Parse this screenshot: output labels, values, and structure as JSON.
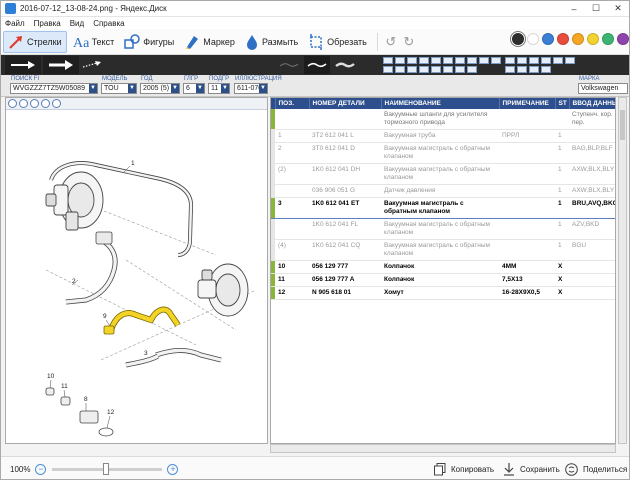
{
  "window": {
    "title": "2016-07-12_13-08-24.png - Яндекс.Диск",
    "min": "–",
    "max": "☐",
    "close": "✕"
  },
  "menu": [
    "Файл",
    "Правка",
    "Вид",
    "Справка"
  ],
  "toolbar": {
    "tools": [
      {
        "label": "Стрелки",
        "icon": "arrow-icon"
      },
      {
        "label": "Текст",
        "icon": "text-icon"
      },
      {
        "label": "Фигуры",
        "icon": "shapes-icon"
      },
      {
        "label": "Маркер",
        "icon": "marker-icon"
      },
      {
        "label": "Размыть",
        "icon": "blur-icon"
      },
      {
        "label": "Обрезать",
        "icon": "crop-icon"
      }
    ],
    "colors": [
      "#2e2e2e",
      "#ffffff",
      "#3a7fd5",
      "#e74c3c",
      "#f5a623",
      "#f1d230",
      "#3cb371",
      "#8e44ad"
    ]
  },
  "catalog": {
    "filters": [
      {
        "label": "ПОИСК FI",
        "value": "WVGZZZ7TZ5W05089"
      },
      {
        "label": "МОДЕЛЬ",
        "value": "TOU"
      },
      {
        "label": "ГОД",
        "value": "2005 (5)"
      },
      {
        "label": "ГЛГР",
        "value": "6"
      },
      {
        "label": "ПОДГР",
        "value": "11"
      },
      {
        "label": "ИЛЛЮСТРАЦИЯ",
        "value": "611-070"
      }
    ],
    "brand_label": "МАРКА",
    "brand_value": "Volkswagen",
    "callouts": [
      "1",
      "2",
      "3",
      "9",
      "10",
      "11",
      "8",
      "12"
    ],
    "table": {
      "headers": [
        "ПОЗ.",
        "НОМЕР ДЕТАЛИ",
        "НАИМЕНОВАНИЕ",
        "ПРИМЕЧАНИЕ",
        "ST",
        "ВВОД ДАННЫХ"
      ],
      "rows": [
        {
          "state": "head",
          "pos": "",
          "part": "",
          "name": "Вакуумные шланги для усилителя тормозного привода",
          "note": "",
          "st": "",
          "data": "Ступенч. кор. пер."
        },
        {
          "state": "ghost",
          "pos": "1",
          "part": "3T2 612 041 L",
          "name": "Вакуумная труба",
          "note": "ПРРЛ",
          "st": "1",
          "data": ""
        },
        {
          "state": "ghost",
          "pos": "2",
          "part": "3T0 612 041 D",
          "name": "Вакуумная магистраль с обратным клапаном",
          "note": "",
          "st": "1",
          "data": "BAG,BLP,BLF"
        },
        {
          "state": "ghost",
          "pos": "(2)",
          "part": "1K0 612 041 DH",
          "name": "Вакуумная магистраль с обратным клапаном",
          "note": "",
          "st": "1",
          "data": "AXW,BLX,BLY"
        },
        {
          "state": "ghost",
          "pos": "",
          "part": "036 906 051 G",
          "name": "Датчик давления",
          "note": "",
          "st": "1",
          "data": "AXW,BLX,BLY"
        },
        {
          "state": "selected",
          "pos": "3",
          "part": "1K0 612 041 ET",
          "name": "Вакуумная магистраль с обратным клапаном",
          "note": "",
          "st": "1",
          "data": "BRU,AVQ,BKC"
        },
        {
          "state": "ghost",
          "pos": "",
          "part": "1K0 612 041 FL",
          "name": "Вакуумная магистраль с обратным клапаном",
          "note": "",
          "st": "1",
          "data": "AZV,BKD"
        },
        {
          "state": "ghost",
          "pos": "(4)",
          "part": "1K0 612 041 CQ",
          "name": "Вакуумная магистраль с обратным клапаном",
          "note": "",
          "st": "1",
          "data": "BGU"
        },
        {
          "state": "normal",
          "pos": "10",
          "part": "056 129 777",
          "name": "Колпачок",
          "note": "4MM",
          "st": "X",
          "data": ""
        },
        {
          "state": "normal",
          "pos": "11",
          "part": "056 129 777 A",
          "name": "Колпачок",
          "note": "7,5X13",
          "st": "X",
          "data": ""
        },
        {
          "state": "normal",
          "pos": "12",
          "part": "N   905 618 01",
          "name": "Хомут",
          "note": "16-28X9X0,5",
          "st": "X",
          "data": ""
        }
      ]
    }
  },
  "status": {
    "zoom": "100%",
    "zoom_out": "−",
    "zoom_in": "+",
    "copy": "Копировать",
    "save": "Сохранить",
    "share": "Поделиться"
  }
}
